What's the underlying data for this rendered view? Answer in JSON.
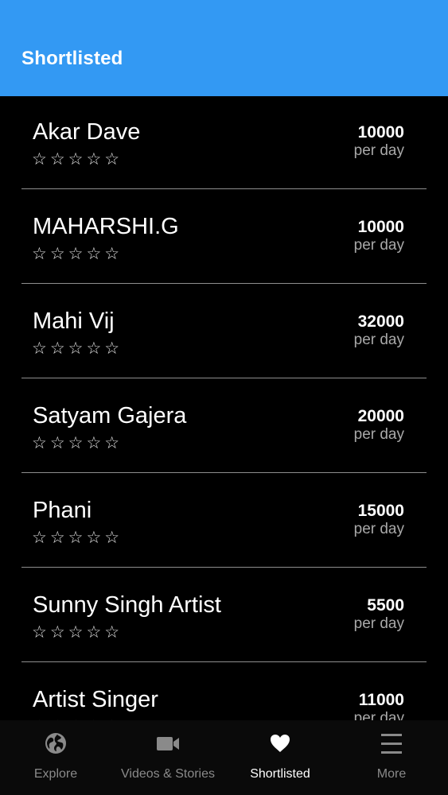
{
  "header": {
    "title": "Shortlisted"
  },
  "list": {
    "items": [
      {
        "name": "Akar Dave",
        "rating": "☆☆☆☆☆",
        "price": "10000",
        "unit": "per day"
      },
      {
        "name": "MAHARSHI.G",
        "rating": "☆☆☆☆☆",
        "price": "10000",
        "unit": "per day"
      },
      {
        "name": "Mahi Vij",
        "rating": "☆☆☆☆☆",
        "price": "32000",
        "unit": "per day"
      },
      {
        "name": "Satyam Gajera",
        "rating": "☆☆☆☆☆",
        "price": "20000",
        "unit": "per day"
      },
      {
        "name": "Phani",
        "rating": "☆☆☆☆☆",
        "price": "15000",
        "unit": "per day"
      },
      {
        "name": "Sunny Singh Artist",
        "rating": "☆☆☆☆☆",
        "price": "5500",
        "unit": "per day"
      },
      {
        "name": "Artist Singer",
        "rating": "☆☆☆☆☆",
        "price": "11000",
        "unit": "per day"
      }
    ]
  },
  "tabbar": {
    "tabs": [
      {
        "label": "Explore",
        "icon": "globe-icon"
      },
      {
        "label": "Videos & Stories",
        "icon": "video-camera-icon"
      },
      {
        "label": "Shortlisted",
        "icon": "heart-icon",
        "active": true
      },
      {
        "label": "More",
        "icon": "menu-icon"
      }
    ]
  },
  "colors": {
    "header": "#3399f3",
    "background": "#000000",
    "active_tab": "#ffffff",
    "inactive_tab": "#8a8a8a"
  }
}
